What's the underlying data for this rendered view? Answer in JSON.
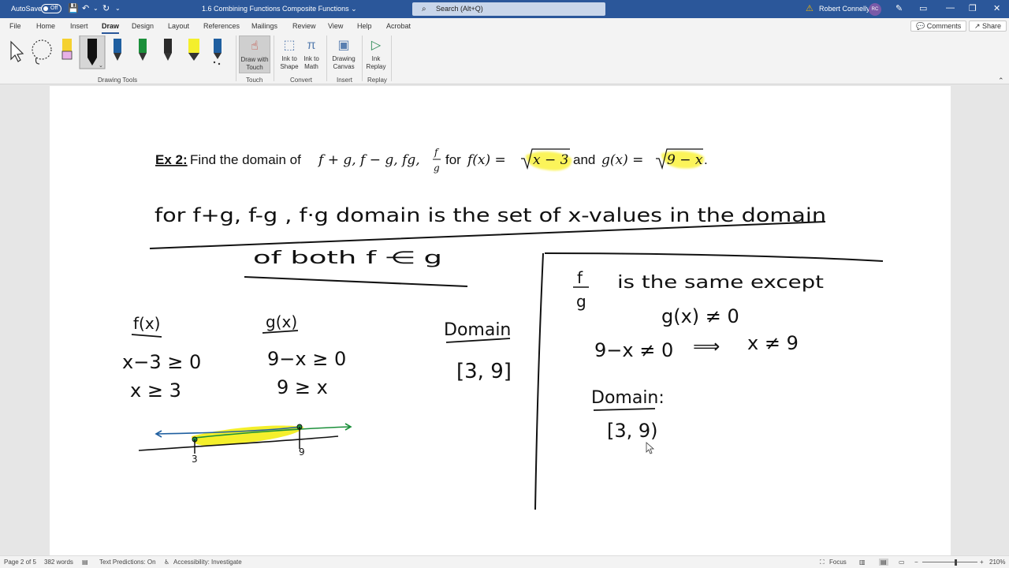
{
  "titlebar": {
    "autosave_label": "AutoSave",
    "autosave_state": "Off",
    "doc_title": "1.6 Combining Functions Composite Functions",
    "search_placeholder": "Search (Alt+Q)",
    "user_name": "Robert Connelly",
    "user_initials": "RC"
  },
  "tabs": [
    "File",
    "Home",
    "Insert",
    "Draw",
    "Design",
    "Layout",
    "References",
    "Mailings",
    "Review",
    "View",
    "Help",
    "Acrobat"
  ],
  "active_tab": "Draw",
  "header_buttons": {
    "comments": "Comments",
    "share": "Share"
  },
  "ribbon": {
    "groups": {
      "drawing_tools": "Drawing Tools",
      "touch": "Touch",
      "convert": "Convert",
      "insert": "Insert",
      "replay": "Replay"
    },
    "buttons": {
      "draw_with_touch": "Draw with Touch",
      "ink_to_shape": "Ink to Shape",
      "ink_to_math": "Ink to Math",
      "drawing_canvas": "Drawing Canvas",
      "ink_replay": "Ink Replay"
    },
    "pen_colors": [
      "#f5d130",
      "#111111",
      "#1f5fa0",
      "#1b8f3a",
      "#2a2a2a",
      "#f4ef2c",
      "#1f5fa0"
    ]
  },
  "document": {
    "ex_label": "Ex 2:",
    "prompt_text": "Find the domain of",
    "ops": "f + g, f − g, fg, ",
    "frac_num": "f",
    "frac_den": "g",
    "for_word": "for",
    "f_def_lhs": "f(x) = ",
    "f_root": "x − 3",
    "and_word": "and",
    "g_def_lhs": "g(x) = ",
    "g_root": "9 − x",
    "period": ".",
    "highlight_color": "#fbf45a",
    "handwriting": {
      "line1": "for   f+g,  f-g , f·g   domain  is  the  set  of  x-values  in  the  domain",
      "line2": "of   both    f  ⋲  g",
      "fx_label": "f(x)",
      "gx_label": "g(x)",
      "fx_ineq1": "x−3 ≥ 0",
      "fx_ineq2": "x ≥ 3",
      "gx_ineq1": "9−x ≥ 0",
      "gx_ineq2": "9 ≥ x",
      "domain_label": "Domain",
      "domain_value": "[3, 9]",
      "numline_left": "3",
      "numline_right": "9",
      "fg_num": "f",
      "fg_den": "g",
      "same_except": "is   the   same   except",
      "gx_neq": "g(x) ≠ 0",
      "neq_line": "9−x ≠ 0",
      "implies": "⟹",
      "x_neq": "x ≠ 9",
      "domain2_label": "Domain:",
      "domain2_value": "[3, 9)"
    }
  },
  "status": {
    "page": "Page 2 of 5",
    "words": "382 words",
    "text_predictions": "Text Predictions: On",
    "accessibility": "Accessibility: Investigate",
    "focus": "Focus",
    "zoom": "210%"
  }
}
